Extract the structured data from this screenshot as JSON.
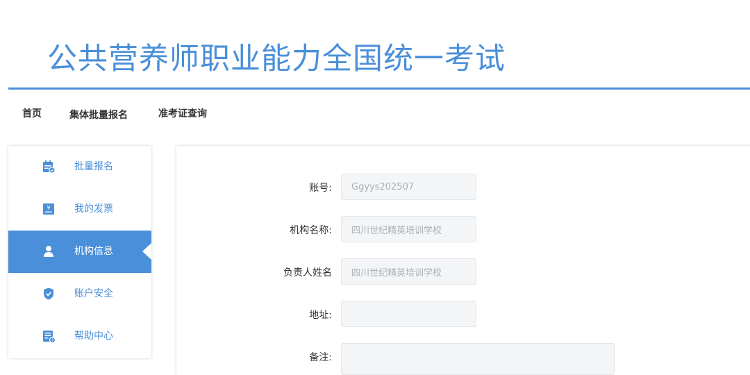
{
  "header": {
    "title": "公共营养师职业能力全国统一考试"
  },
  "nav": {
    "home": "首页",
    "batch_registration": "集体批量报名",
    "admission_ticket_query": "准考证查询"
  },
  "sidebar": {
    "items": [
      {
        "label": "批量报名",
        "icon": "calendar-check-icon",
        "active": false
      },
      {
        "label": "我的发票",
        "icon": "invoice-yen-icon",
        "active": false
      },
      {
        "label": "机构信息",
        "icon": "user-icon",
        "active": true
      },
      {
        "label": "账户安全",
        "icon": "shield-check-icon",
        "active": false
      },
      {
        "label": "帮助中心",
        "icon": "document-help-icon",
        "active": false
      }
    ]
  },
  "form": {
    "account": {
      "label": "账号:",
      "value": "Ggyys202507"
    },
    "org_name": {
      "label": "机构名称:",
      "value": "四川世纪精英培训学校"
    },
    "contact_name": {
      "label": "负责人姓名",
      "value": "四川世纪精英培训学校"
    },
    "address": {
      "label": "地址:",
      "value": ""
    },
    "remark": {
      "label": "备注:",
      "value": ""
    }
  },
  "colors": {
    "accent": "#4a8fd9",
    "input_bg": "#f3f5f7",
    "input_text": "#a9b0b7"
  }
}
